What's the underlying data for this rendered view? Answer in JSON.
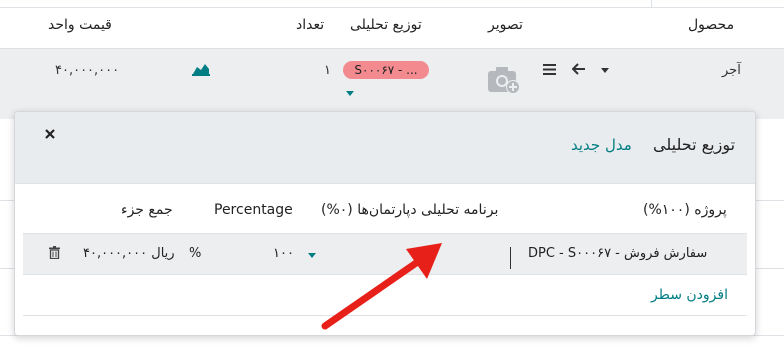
{
  "table": {
    "headers": {
      "product": "محصول",
      "image": "تصویر",
      "analytic_distribution": "توزیع تحلیلی",
      "quantity": "تعداد",
      "unit_price": "قیمت واحد"
    },
    "row": {
      "product": "آجر",
      "analytic_badge": "S۰۰۰۶۷ - ...",
      "quantity": "۱",
      "unit_price": "۴۰,۰۰۰,۰۰۰"
    }
  },
  "popup": {
    "title": "توزیع تحلیلی",
    "new_model": "مدل جدید",
    "columns": {
      "project": "پروژه (۱۰۰%)",
      "department_plan": "برنامه تحلیلی دپارتمان‌ها (۰%)",
      "percentage": "Percentage",
      "subtotal": "جمع جزء"
    },
    "line": {
      "account": "DPC - S۰۰۰۶۷ - سفارش فروش",
      "percentage_value": "۱۰۰",
      "percent_sign": "%",
      "subtotal_value": "۴۰,۰۰۰,۰۰۰ ریال"
    },
    "add_line": "افزودن سطر"
  },
  "colors": {
    "accent": "#017e84",
    "badge": "#f28a8f",
    "arrow": "#e8201a"
  },
  "icons": [
    "chevron-down-icon",
    "arrow-left-icon",
    "hamburger-icon",
    "camera-add-icon",
    "area-chart-icon",
    "close-icon",
    "trash-icon"
  ]
}
